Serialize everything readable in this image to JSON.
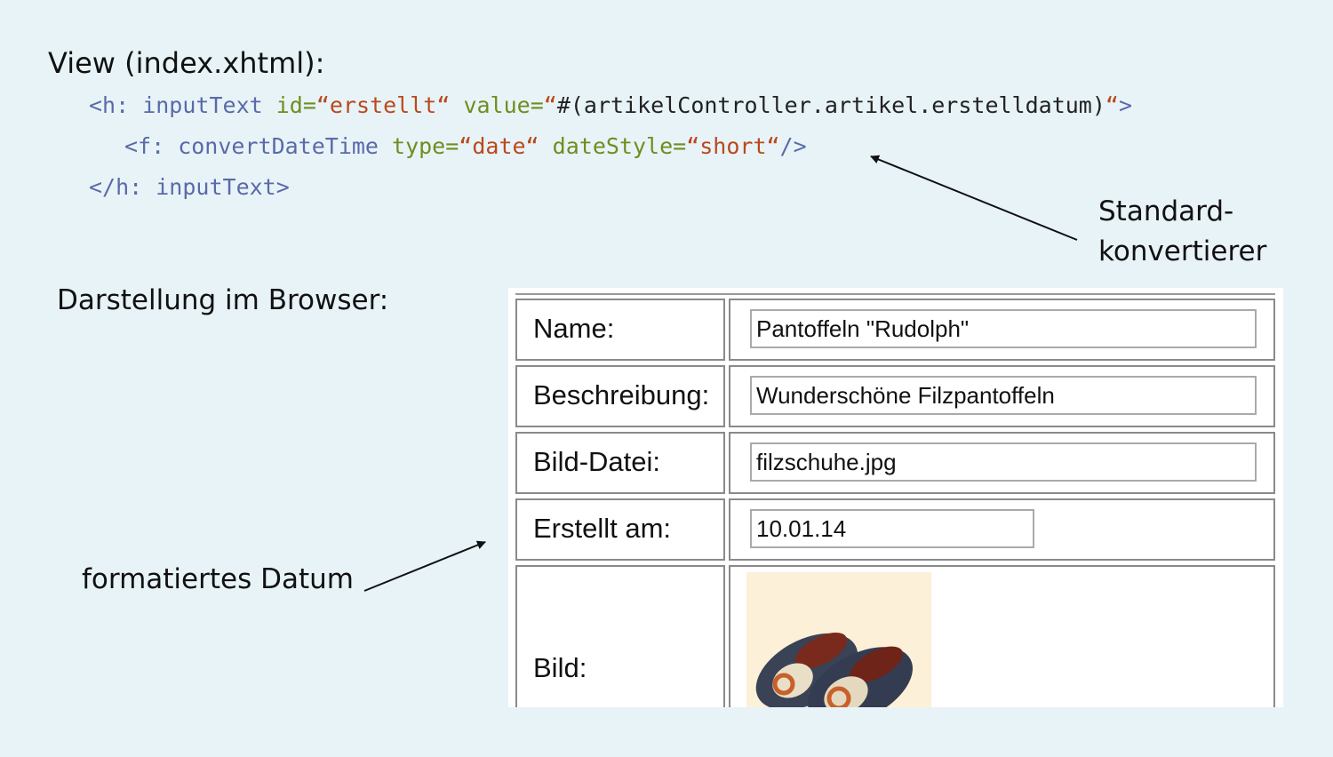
{
  "view_title": "View (index.xhtml):",
  "code": {
    "line1": {
      "tag_open": "<h: inputText ",
      "attr_id": "id=",
      "val_id": "“erstellt“",
      "attr_value": " value=",
      "q_open": "“",
      "expr": "#(artikelController.artikel.erstelldatum)",
      "q_close": "“",
      "tag_end": ">"
    },
    "line2": {
      "tag_open": "<f: convertDateTime ",
      "attr_type": "type=",
      "val_type": "“date“",
      "attr_style": " dateStyle=",
      "val_style": "“short“",
      "tag_end": "/>"
    },
    "line3": "</h: inputText>"
  },
  "annotations": {
    "std_line1": "Standard-",
    "std_line2": "konvertierer",
    "browser_label": "Darstellung im Browser:",
    "date_label": "formatiertes Datum"
  },
  "form": {
    "rows": [
      {
        "label": "Name:",
        "value": "Pantoffeln \"Rudolph\""
      },
      {
        "label": "Beschreibung:",
        "value": "Wunderschöne Filzpantoffeln"
      },
      {
        "label": "Bild-Datei:",
        "value": "filzschuhe.jpg"
      },
      {
        "label": "Erstellt am:",
        "value": "10.01.14"
      },
      {
        "label": "Bild:"
      }
    ]
  }
}
